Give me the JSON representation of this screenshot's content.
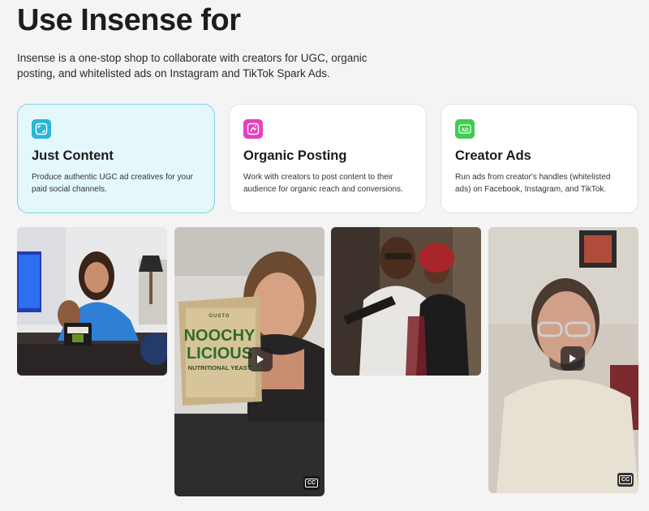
{
  "heading": "Use Insense for",
  "intro": "Insense is a one-stop shop to collaborate with creators for UGC, organic posting, and whitelisted ads on Instagram and TikTok Spark Ads.",
  "cards": [
    {
      "title": "Just Content",
      "description": "Produce authentic UGC ad creatives for your paid social channels.",
      "icon": "frame-icon",
      "icon_color": "#29b6d8",
      "selected": true
    },
    {
      "title": "Organic Posting",
      "description": "Work with creators to post content to their audience for organic reach and conversions.",
      "icon": "sparkle-icon",
      "icon_color": "#e83fbf",
      "selected": false
    },
    {
      "title": "Creator Ads",
      "description": "Run ads from creator's handles (whitelisted ads) on Facebook, Instagram, and TikTok.",
      "icon": "ad-icon",
      "icon_color": "#3ccf4e",
      "selected": false
    }
  ],
  "media": {
    "product_brand": "GUSTO",
    "product_line1": "NOOCHY",
    "product_line2": "LICIOUS",
    "product_line3": "NUTRITIONAL YEAST",
    "cc_label": "CC"
  }
}
